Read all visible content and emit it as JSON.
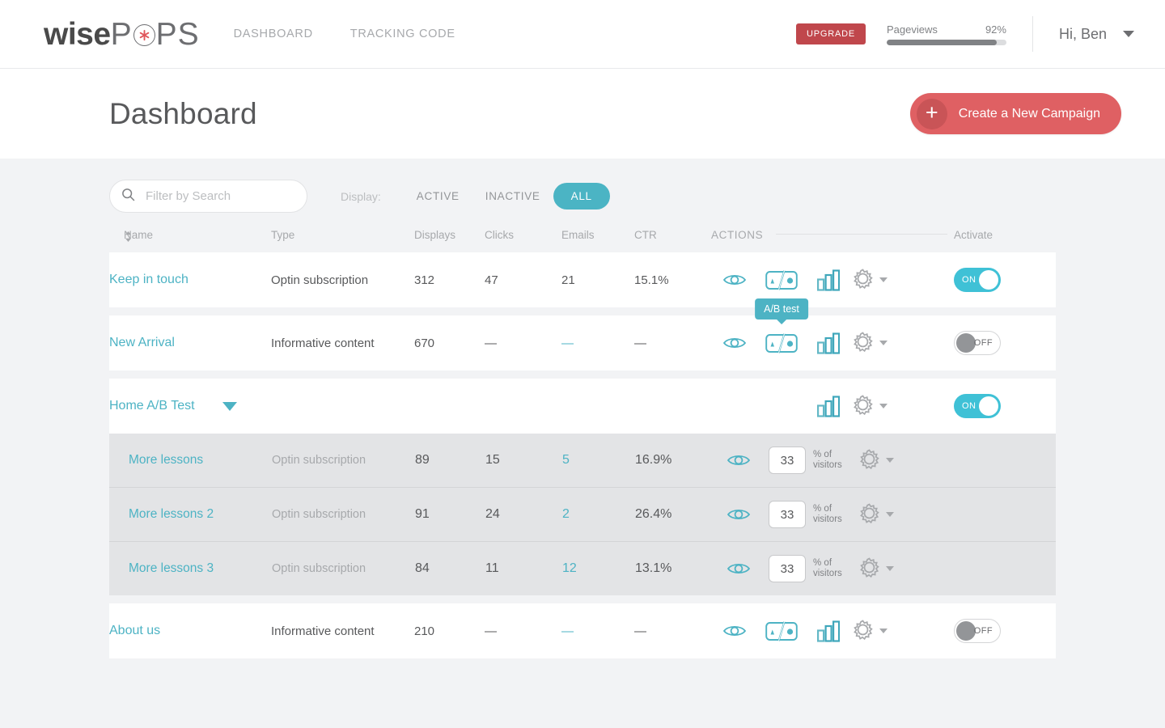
{
  "brand": {
    "logo_wise": "wise",
    "logo_p": "P",
    "logo_ps": "PS",
    "star_icon": "asterisk-icon"
  },
  "nav": {
    "items": [
      {
        "label": "DASHBOARD",
        "name": "nav-dashboard"
      },
      {
        "label": "TRACKING CODE",
        "name": "nav-tracking-code"
      }
    ]
  },
  "account": {
    "upgrade_label": "UPGRADE",
    "pageviews_label": "Pageviews",
    "pageviews_percent": "92%",
    "pageviews_fill": 92,
    "greeting": "Hi, Ben"
  },
  "page": {
    "title": "Dashboard",
    "create_campaign_label": "Create a New Campaign",
    "create_campaign_plus": "+"
  },
  "filters": {
    "search_placeholder": "Filter by Search",
    "search_value": "",
    "display_label": "Display:",
    "segments": [
      {
        "label": "ACTIVE",
        "active": false
      },
      {
        "label": "INACTIVE",
        "active": false
      },
      {
        "label": "ALL",
        "active": true
      }
    ]
  },
  "table": {
    "headers": {
      "name": "Name",
      "type": "Type",
      "displays": "Displays",
      "clicks": "Clicks",
      "emails": "Emails",
      "ctr": "CTR",
      "actions": "ACTIONS",
      "activate": "Activate"
    },
    "rows": [
      {
        "name": "Keep in touch",
        "type": "Optin subscription",
        "displays": "312",
        "clicks": "47",
        "emails": "21",
        "ctr": "15.1%",
        "toggle": "ON",
        "tooltip": "A/B test"
      },
      {
        "name": "New Arrival",
        "type": "Informative content",
        "displays": "670",
        "clicks": "—",
        "emails": "—",
        "ctr": "—",
        "toggle": "OFF"
      }
    ],
    "group": {
      "name": "Home A/B Test",
      "toggle": "ON",
      "variants": [
        {
          "name": "More lessons",
          "type": "Optin subscription",
          "displays": "89",
          "clicks": "15",
          "emails": "5",
          "ctr": "16.9%",
          "percent": "33",
          "percent_label_line1": "% of",
          "percent_label_line2": "visitors"
        },
        {
          "name": "More lessons 2",
          "type": "Optin subscription",
          "displays": "91",
          "clicks": "24",
          "emails": "2",
          "ctr": "26.4%",
          "percent": "33",
          "percent_label_line1": "% of",
          "percent_label_line2": "visitors"
        },
        {
          "name": "More lessons 3",
          "type": "Optin subscription",
          "displays": "84",
          "clicks": "11",
          "emails": "12",
          "ctr": "13.1%",
          "percent": "33",
          "percent_label_line1": "% of",
          "percent_label_line2": "visitors"
        }
      ]
    },
    "last_row": {
      "name": "About us",
      "type": "Informative content",
      "displays": "210",
      "clicks": "—",
      "emails": "—",
      "ctr": "—",
      "toggle": "OFF"
    }
  },
  "colors": {
    "teal": "#4db3c4",
    "teal_bright": "#3fc1d6",
    "red": "#df6063",
    "red_dark": "#c0474c",
    "page_bg": "#f2f3f5",
    "variant_bg": "#e3e4e6"
  }
}
